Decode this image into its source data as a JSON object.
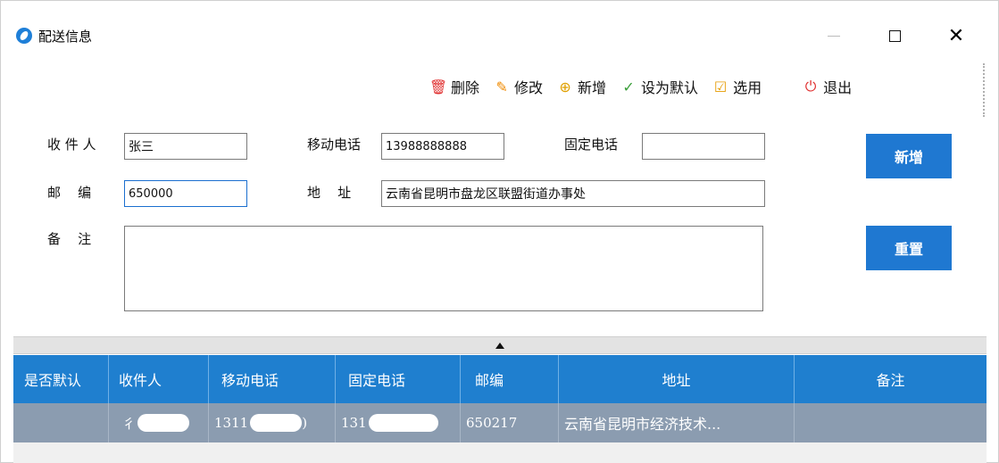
{
  "window": {
    "title": "配送信息",
    "close_glyph": "✕"
  },
  "toolbar": {
    "delete_label": "删除",
    "edit_label": "修改",
    "add_label": "新增",
    "set_default_label": "设为默认",
    "select_label": "选用",
    "exit_label": "退出"
  },
  "form": {
    "recipient_label": "收 件 人",
    "recipient_value": "张三",
    "mobile_label": "移动电话",
    "mobile_value": "13988888888",
    "landline_label": "固定电话",
    "landline_value": "",
    "zip_label": "邮    编",
    "zip_value": "650000",
    "address_label": "地    址",
    "address_value": "云南省昆明市盘龙区联盟街道办事处",
    "remark_label": "备    注",
    "remark_value": "",
    "add_button": "新增",
    "reset_button": "重置"
  },
  "grid": {
    "columns": [
      "是否默认",
      "收件人",
      "移动电话",
      "固定电话",
      "邮编",
      "地址",
      "备注"
    ],
    "rows": [
      {
        "is_default": "",
        "recipient": "彳",
        "mobile": "1311",
        "mobile_tail": ")",
        "landline": "131",
        "landline_tail": "",
        "zip": "650217",
        "address": "云南省昆明市经济技术...",
        "remark": ""
      }
    ]
  },
  "colors": {
    "accent": "#1f78d1",
    "header_bg": "#1f7fcf",
    "selected_row": "#8b9cb0"
  }
}
